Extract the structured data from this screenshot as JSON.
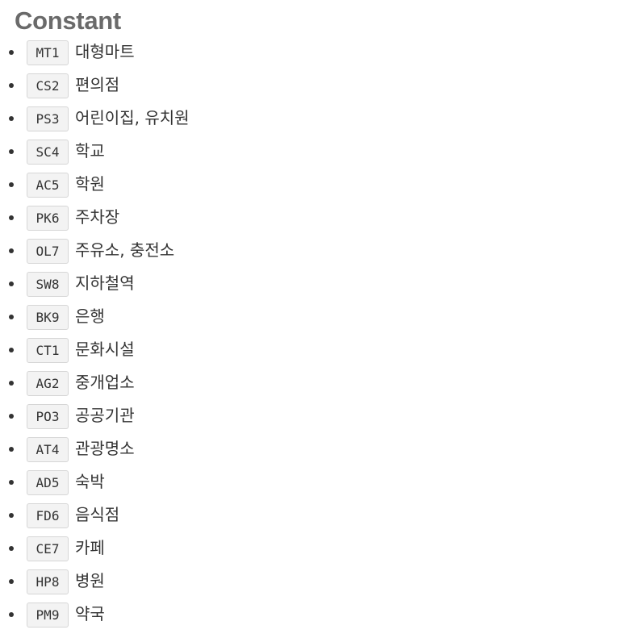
{
  "heading": "Constant",
  "items": [
    {
      "code": "MT1",
      "label": "대형마트"
    },
    {
      "code": "CS2",
      "label": "편의점"
    },
    {
      "code": "PS3",
      "label": "어린이집, 유치원"
    },
    {
      "code": "SC4",
      "label": "학교"
    },
    {
      "code": "AC5",
      "label": "학원"
    },
    {
      "code": "PK6",
      "label": "주차장"
    },
    {
      "code": "OL7",
      "label": "주유소, 충전소"
    },
    {
      "code": "SW8",
      "label": "지하철역"
    },
    {
      "code": "BK9",
      "label": "은행"
    },
    {
      "code": "CT1",
      "label": "문화시설"
    },
    {
      "code": "AG2",
      "label": "중개업소"
    },
    {
      "code": "PO3",
      "label": "공공기관"
    },
    {
      "code": "AT4",
      "label": "관광명소"
    },
    {
      "code": "AD5",
      "label": "숙박"
    },
    {
      "code": "FD6",
      "label": "음식점"
    },
    {
      "code": "CE7",
      "label": "카페"
    },
    {
      "code": "HP8",
      "label": "병원"
    },
    {
      "code": "PM9",
      "label": "약국"
    }
  ]
}
